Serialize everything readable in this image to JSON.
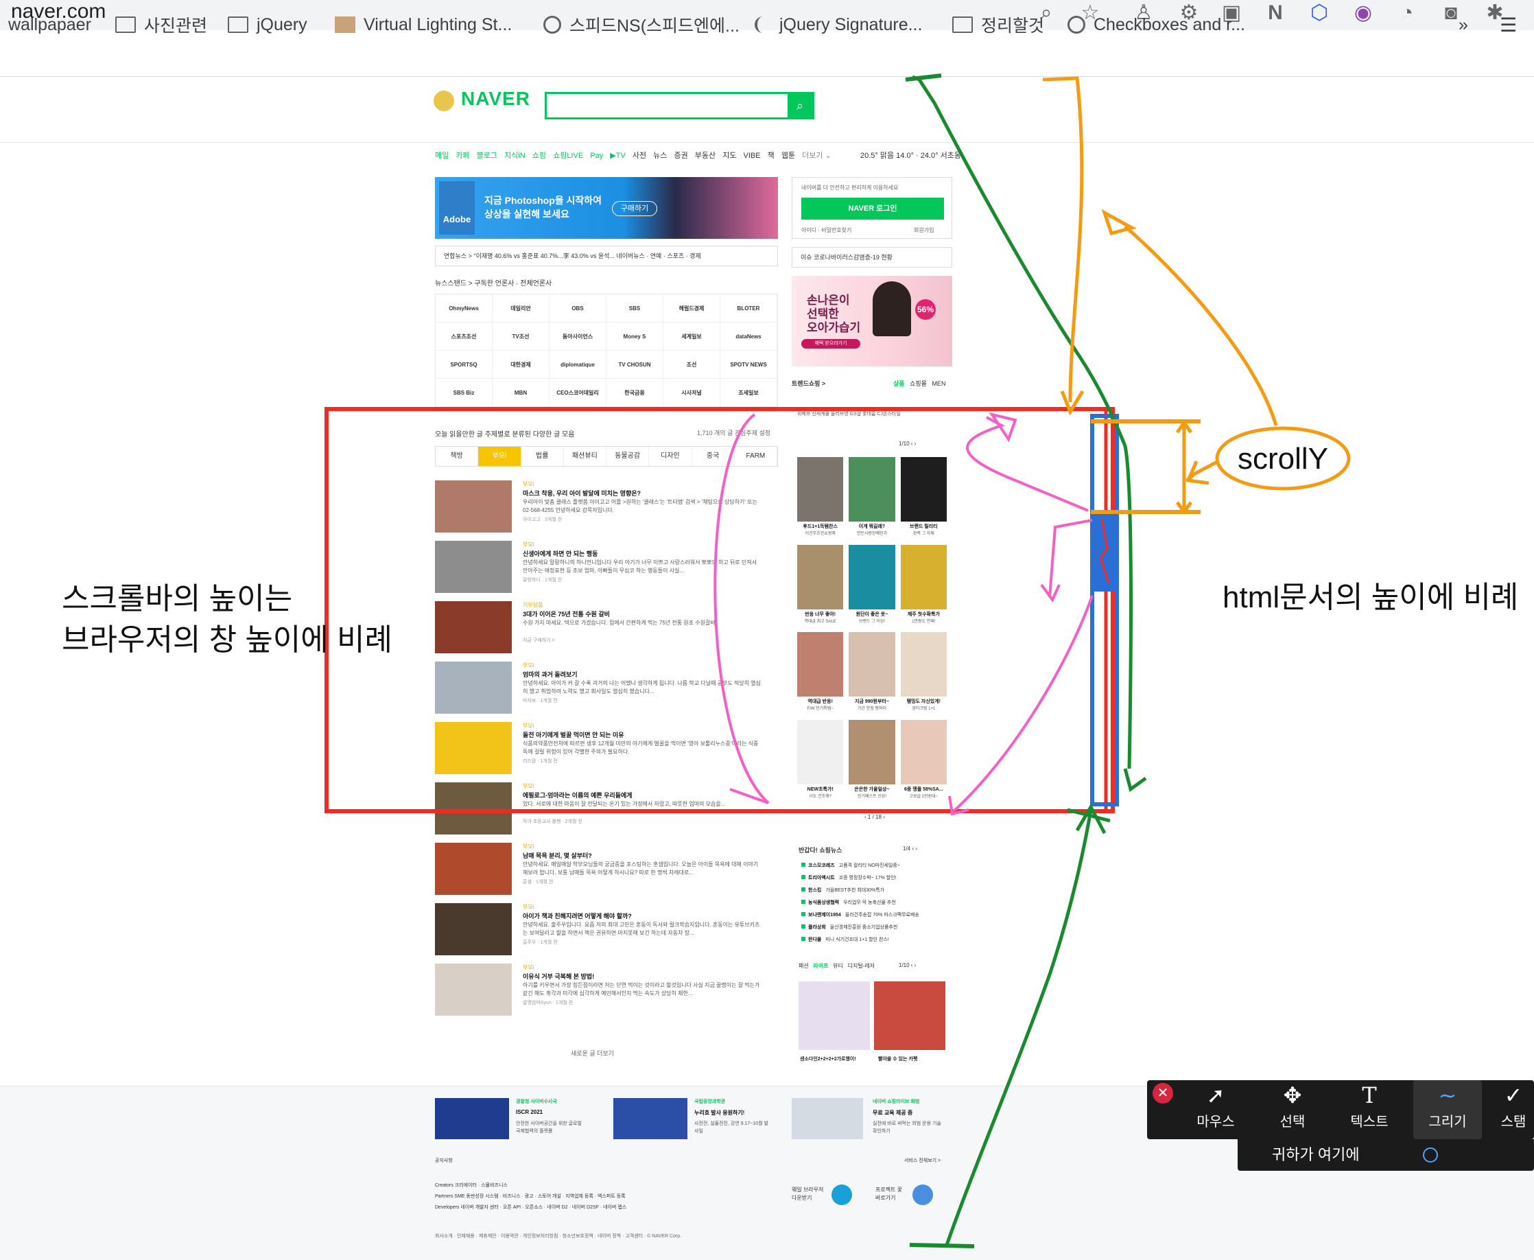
{
  "browser": {
    "url": "naver.com",
    "bookmarks": [
      "wallpapaer",
      "사진관련",
      "jQuery",
      "Virtual Lighting St...",
      "스피드NS(스피드엔에...",
      "jQuery Signature...",
      "정리할것",
      "Checkboxes and r..."
    ],
    "overflow": "»"
  },
  "naver": {
    "logo": "NAVER",
    "services": [
      "메일",
      "카페",
      "블로그",
      "지식iN",
      "쇼핑",
      "쇼핑LIVE",
      "Pay",
      "▶TV",
      "사전",
      "뉴스",
      "증권",
      "부동산",
      "지도",
      "VIBE",
      "책",
      "웹툰",
      "더보기 ⌄"
    ],
    "weather": "20.5° 맑음  14.0° · 24.0°  서초동",
    "ad_banner": {
      "brand": "Adobe",
      "line1": "지금 Photoshop을 시작하여",
      "line2": "상상을 실현해 보세요",
      "button": "구매하기"
    },
    "ticker": "연합뉴스 > \"이재명 40.6% vs 홍준표 40.7%...李 43.0% vs 윤석...     네이버뉴스 · 연예 · 스포츠 · 경제",
    "newsstand_head": "뉴스스탠드 > 구독한 언론사 · 전체언론사",
    "press": [
      "OhmyNews",
      "데일리안",
      "OBS",
      "SBS",
      "헤럴드경제",
      "BLOTER",
      "스포츠조선",
      "TV조선",
      "동아사이언스",
      "Money S",
      "세계일보",
      "dataNews",
      "SPORTSQ",
      "대한경제",
      "diplomatique",
      "TV CHOSUN",
      "조선",
      "SPOTV NEWS",
      "SBS Biz",
      "MBN",
      "CEO스코어데일리",
      "한국금융",
      "시사저널",
      "조세일보"
    ],
    "readboard_head": "오늘 읽을만한 글  주제별로 분류된 다양한 글 모음",
    "readboard_count": "1,710 개의 글  관심주제 설정",
    "topics": [
      "책방",
      "부모i",
      "법률",
      "패션뷰티",
      "동물공감",
      "디자인",
      "중국",
      "FARM"
    ],
    "articles": [
      {
        "cat": "부모i",
        "title": "마스크 착용, 우리 아이 발달에 미치는 영향은?",
        "desc": "우리아이 맞춤 클래스 플랫폼 아이고고 어플 >원하는 '클래스'는 '트티맵' 검색 > '채팅으로 상담하기' 또는 02-568-4255 안녕하세요 강목자입니다.",
        "meta": "아이고고 · 3개월 전"
      },
      {
        "cat": "부모i",
        "title": "신생아에게 하면 안 되는 행동",
        "desc": "안녕하세요 말랑하니의 하니언니입니다 우리 아기가 너무 이쁘고 사랑스러워서 뽀뽀도 하고 뒤로 던져서 안아주는 애정표현 등 조보 엄마, 아빠들이 무심코 하는 행동들이 사실...",
        "meta": "말랑하니 · 1개월 전"
      },
      {
        "cat": "기부상품",
        "title": "3대가 이어온 75년 전통 수원 갈비",
        "desc": "수원 가지 마세요. 댁으로 가겠습니다. 집에서 간편하게 먹는 75년 전통 원조 수원갈비",
        "meta": "지금 구매하기 >"
      },
      {
        "cat": "부모i",
        "title": "엄마의 과거 돌려보기",
        "desc": "안녕하세요. 아이가 커 갈 수록 과거의 나는 어땠나 생각하게 됩니다. 나름 학교 다닐때 공부도 적당히 열심히 했고 취업하려 노력도 했고 회사일도 열심히 했습니다...",
        "meta": "마자보 · 1개월 전"
      },
      {
        "cat": "부모i",
        "title": "돌전 아기에게 벌꿀 먹이면 안 되는 이유",
        "desc": "식품의약품안전처에 따르면 생후 12개월 미만의 아기에게 벌꿀을 먹이면 '영아 보툴리누스증'이라는 식중독에 걸릴 위험이 있어 각별한 주의가 필요하다.",
        "meta": "리드맘 · 1개월 전"
      },
      {
        "cat": "부모i",
        "title": "에필로그-엄마라는 이름의 예쁜 우리들에게",
        "desc": "었다. 서로에 대한 마음이 잘 전달되는 온기 있는 가정에서 자랐고, 따뜻한 엄마의 모습을...",
        "meta": "작가 초등교사 볼펜 · 2개월 전"
      },
      {
        "cat": "부모i",
        "title": "남매 목욕 분리, 몇 살부터?",
        "desc": "안녕하세요. 매일매일 학부모님들의 궁금증을 포스팅하는 훈샘입니다. 오늘은 아이들 목욕에 대해 이야기해보려 합니다. 보통 남매들 목욕 어떻게 하시나요? 따로 한 명씩 차례대로...",
        "meta": "훈샘 · 1개월 전"
      },
      {
        "cat": "부모i",
        "title": "아이가 책과 친해지려면 어떻게 해야 할까?",
        "desc": "안녕하세요. 출주우입니다. 요즘 저의 최대 고민은 혼동이 독서와 릴크학습지입니다. 혼동이는 유튜브키즈는 보여달라고 할을 하면서 책은 권유하면 마지못해 보긴 하는데 자동차 장...",
        "meta": "출주우 · 1개월 전"
      },
      {
        "cat": "부모i",
        "title": "이유식 거부 극복해 본 방법!",
        "desc": "아기를 키우면서 가장 힘든점이라면 저는 단연 먹이는 것이라고 할것입니다 사실 지금 꿀맹이는 잘 먹는가 같긴 해도 혹각과 미각에 심각하게 예민해서인지 먹는 속도가 상당히 체한...",
        "meta": "꿀맹엄마Syun · 1개월 전"
      }
    ],
    "more_news": "새로운 글 더보기",
    "login": {
      "message": "네이버를 더 안전하고 편리하게 이용하세요",
      "button": "NAVER 로그인",
      "links": "아이디 · 비밀번호찾기",
      "join": "회원가입"
    },
    "covid": "이슈  코로나바이러스감염증-19 현황",
    "ad2": {
      "line1": "손나은이",
      "line2": "선택한",
      "line3": "오아가습기",
      "button": "혜택 받으러가기",
      "badge": "56%"
    },
    "trend": {
      "head": "트렌드쇼핑 >",
      "tabs": [
        "상품",
        "쇼핑몰",
        "MEN"
      ],
      "cats": "위메프  신세계몰  올리브영  GS샵  롯데홈  CJ온스타일",
      "pager": "1/10  ‹ ›",
      "products": [
        {
          "t": "후드1+1득템찬스",
          "s": "이건무조건쇼핑해"
        },
        {
          "t": "이게 뭐길래?",
          "s": "언든사랑한쾌인가"
        },
        {
          "t": "브랜드 릴리티",
          "s": "완벽 그 자체"
        },
        {
          "t": "반응 너무 좋아!",
          "s": "역대급 최고 SALE"
        },
        {
          "t": "원단이 좋은 옷~",
          "s": "브랜드 그 이상!"
        },
        {
          "t": "제주 첫수확특가",
          "s": "1만원도 안돼!"
        },
        {
          "t": "역대급 반응!",
          "s": "F/W 인기특템~"
        },
        {
          "t": "지금 990원부터~",
          "s": "기간 한정 행쳐러"
        },
        {
          "t": "뗑밍도 자신있게!",
          "s": "정티크림 1+1"
        },
        {
          "t": "NEW초특가!",
          "s": "너도 건조해?"
        },
        {
          "t": "은은한 가을일상~",
          "s": "인기베스트 신상!"
        },
        {
          "t": "6종 맹플 58%SA...",
          "s": "고보습 1만원대~"
        }
      ],
      "prod_pager": "‹  1 / 18  ›"
    },
    "shoplist": {
      "head": "반갑다! 쇼핑뉴스",
      "pager": "1/4  ‹ ›",
      "items": [
        {
          "name": "코스모코레즈",
          "text": "고품격 컬리티 NO마진세일중~"
        },
        {
          "name": "트리아엑시트",
          "text": "꼬증 명정장수박~ 17% 할인!"
        },
        {
          "name": "한스킹",
          "text": "가을BEST추천 최대30%특가"
        },
        {
          "name": "농식품상생협력",
          "text": "우리업무 막 농축산물 추천"
        },
        {
          "name": "보나앤제이1954",
          "text": "올라건주송잡 70% 마스크팩무료배송"
        },
        {
          "name": "플라상회",
          "text": "울산경제진흥원 중소기업상품추천"
        },
        {
          "name": "한다몰",
          "text": "미니 식기건조대 1+1 할인 찬스!"
        }
      ]
    },
    "cat_tabs": [
      "패션",
      "라이프",
      "뷰티",
      "디지털-레저"
    ],
    "cat_pager": "1/10  ‹ ›",
    "cat_caps": [
      "센소다인2+2+2+2가로챙이!",
      "빨아쓸 수 있는 카펫"
    ],
    "footer": {
      "banners": [
        {
          "title": "경찰청 사이버수사국",
          "sub": "ISCR 2021",
          "desc": "안전한 사이버공간을 위한 글로벌 국제협력의 플랫폼"
        },
        {
          "title": "국립중앙과학관",
          "sub": "누리호 발사 응원하기!",
          "desc": "사전전, 실물전진, 강연 9.17~10월 발사일"
        },
        {
          "title": "네이버 쇼핑라이브 희범",
          "sub": "무료 교육 제공 중",
          "desc": "실전에 바로 써먹는 희범 운용 기술 확인하기"
        }
      ],
      "notice": "공지사항",
      "service_all": "서비스 전체보기 >",
      "creators": "Creators   크리에이터 · 스몰비즈니스",
      "partners": "Partners   SME 동반성장 시스템 · 비즈니스 · 광고 · 스토어 개설 · 지역업체 등록 · 엑스퍼트 등록",
      "developers": "Developers   네이버 개발자 센터 · 오픈 API · 오픈소스 · 네이버 D2 · 네이버 D2SF · 네이버 랩스",
      "whale": "웨일 브라우저\n다운받기",
      "project": "프로젝트 꽃\n바로가기",
      "copyright": "회사소개 · 인재채용 · 제휴제안 · 이용약관 · 개인정보처리방침 · 청소년보호정책 · 네이버 정책 · 고객센터 · © NAVER Corp."
    }
  },
  "annotations": {
    "scrollbar_note_line1": "스크롤바의 높이는",
    "scrollbar_note_line2": "브라우저의 창 높이에 비례",
    "html_note": "html문서의 높이에 비례",
    "scrolly_label": "scrollY",
    "colors": {
      "red": "#ef2b24",
      "green": "#1a8a2e",
      "orange": "#f59b12",
      "pink": "#f45fc7",
      "blue": "#2a6fd6"
    }
  },
  "toolbar": {
    "tools": [
      "마우스",
      "선택",
      "텍스트",
      "그리기",
      "스탬"
    ],
    "presence": "귀하가 여기에"
  }
}
